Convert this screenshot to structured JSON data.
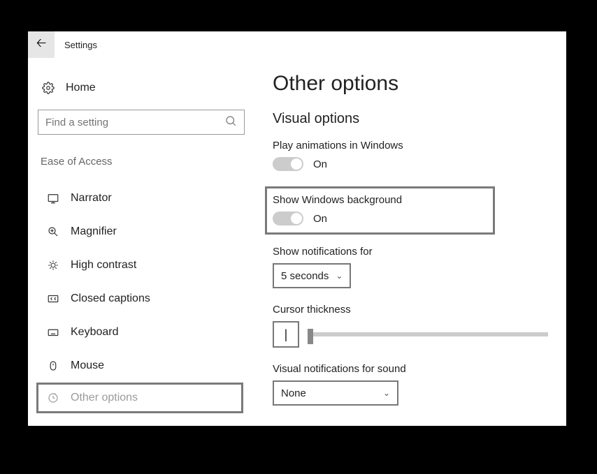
{
  "titlebar": {
    "title": "Settings"
  },
  "sidebar": {
    "home_label": "Home",
    "search_placeholder": "Find a setting",
    "category": "Ease of Access",
    "items": [
      {
        "label": "Narrator"
      },
      {
        "label": "Magnifier"
      },
      {
        "label": "High contrast"
      },
      {
        "label": "Closed captions"
      },
      {
        "label": "Keyboard"
      },
      {
        "label": "Mouse"
      },
      {
        "label": "Other options"
      }
    ]
  },
  "main": {
    "title": "Other options",
    "section": "Visual options",
    "play_animations": {
      "label": "Play animations in Windows",
      "value": "On"
    },
    "show_background": {
      "label": "Show Windows background",
      "value": "On"
    },
    "notifications": {
      "label": "Show notifications for",
      "value": "5 seconds"
    },
    "cursor": {
      "label": "Cursor thickness",
      "preview": "|"
    },
    "visual_notify": {
      "label": "Visual notifications for sound",
      "value": "None"
    }
  }
}
